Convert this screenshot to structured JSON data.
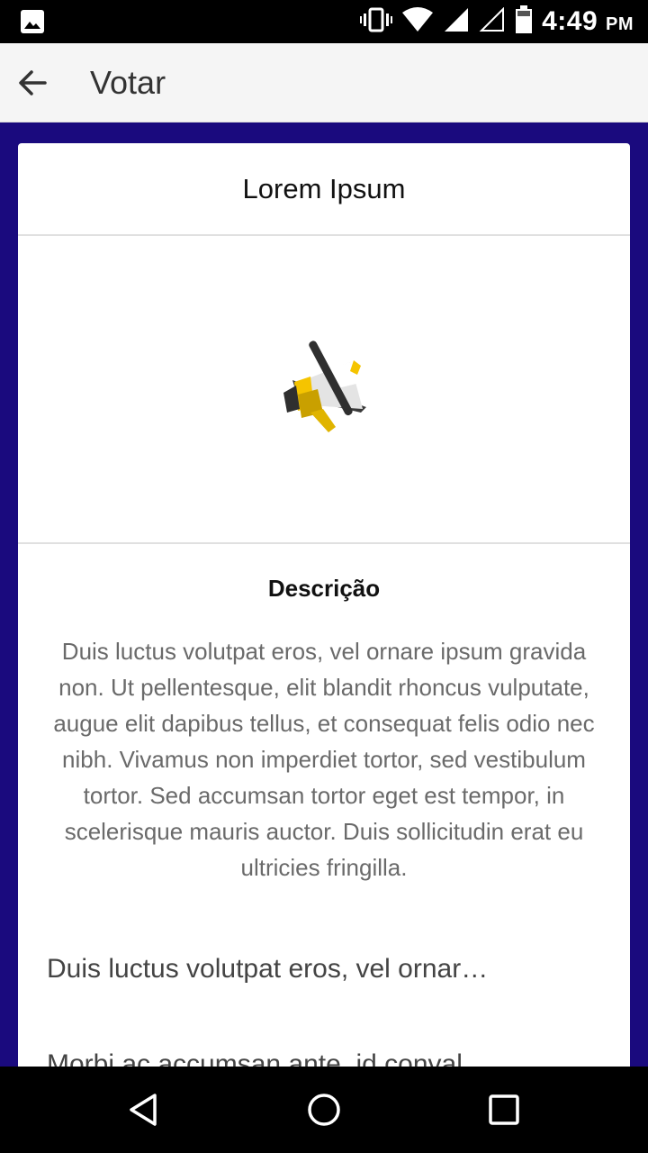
{
  "status_bar": {
    "time": "4:49",
    "ampm": "PM",
    "icons": [
      "image-icon",
      "vibrate-icon",
      "wifi-icon",
      "signal-icon",
      "signal-empty-icon",
      "battery-icon"
    ]
  },
  "app_bar": {
    "title": "Votar",
    "back_icon": "arrow-back-icon"
  },
  "card": {
    "title": "Lorem Ipsum",
    "image_icon": "megaphone-icon",
    "description_title": "Descrição",
    "description": "Duis luctus volutpat eros, vel ornare ipsum gravida non. Ut pellentesque, elit blandit rhoncus vulputate, augue elit dapibus tellus, et consequat felis odio nec nibh. Vivamus non imperdiet tortor, sed vestibulum tortor. Sed accumsan tortor eget est tempor, in scelerisque mauris auctor. Duis sollicitudin erat eu ultricies fringilla.",
    "options": [
      "Duis luctus volutpat eros, vel ornar…",
      "Morbi ac accumsan ante, id conval…"
    ]
  },
  "nav_bar": {
    "icons": [
      "back-triangle-icon",
      "home-circle-icon",
      "recents-square-icon"
    ]
  },
  "colors": {
    "background": "#1a0a7e",
    "app_bar": "#f5f5f5",
    "card": "#ffffff"
  }
}
